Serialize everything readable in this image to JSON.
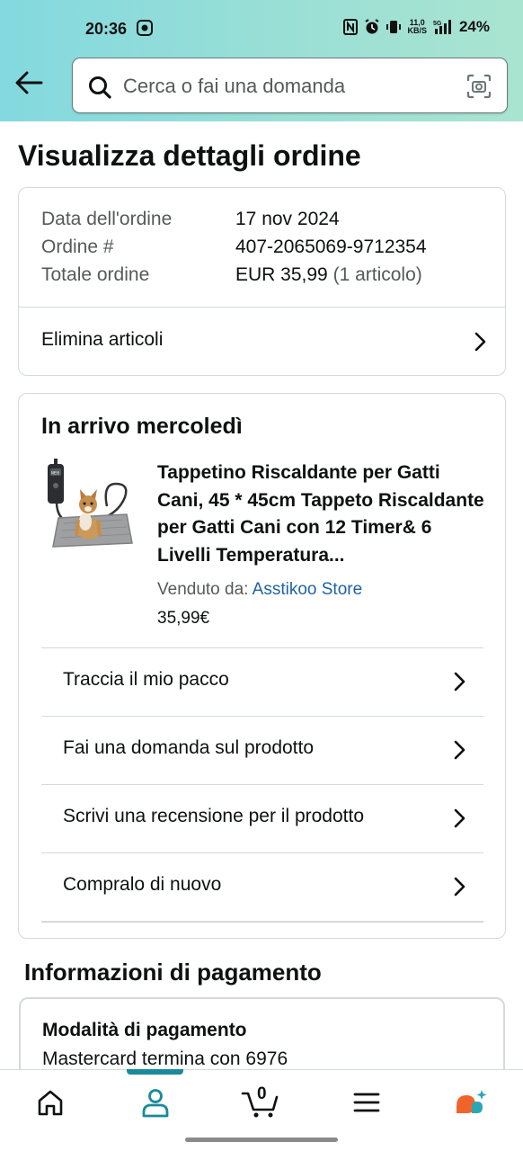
{
  "status_bar": {
    "time": "20:36",
    "network_speed_top": "11,0",
    "network_speed_bottom": "KB/S",
    "battery": "24%"
  },
  "header": {
    "back_icon": "arrow-left-icon",
    "search_placeholder": "Cerca o fai una domanda",
    "search_icon": "search-icon",
    "camera_icon": "camera-scan-icon"
  },
  "page": {
    "title": "Visualizza dettagli ordine"
  },
  "order_summary": {
    "date_label": "Data dell'ordine",
    "date_value": "17 nov 2024",
    "number_label": "Ordine #",
    "number_value": "407-2065069-9712354",
    "total_label": "Totale ordine",
    "total_value": "EUR 35,99",
    "total_items": "(1 articolo)",
    "delete_action": "Elimina articoli"
  },
  "shipment": {
    "heading": "In arrivo mercoledì",
    "product_title": "Tappetino Riscaldante per Gatti Cani, 45 * 45cm Tappeto Riscaldante per Gatti Cani con 12 Timer& 6 Livelli Temperatura...",
    "seller_label": "Venduto da:",
    "seller_name": "Asstikoo Store",
    "price": "35,99€",
    "actions": [
      "Traccia il mio pacco",
      "Fai una domanda sul prodotto",
      "Scrivi una recensione per il prodotto",
      "Compralo di nuovo"
    ]
  },
  "payment": {
    "section_title": "Informazioni di pagamento",
    "method_label": "Modalità di pagamento",
    "method_value": "Mastercard termina con 6976"
  },
  "bottom_nav": {
    "items": [
      "home-icon",
      "account-icon",
      "cart-icon",
      "menu-icon",
      "rufus-ai-icon"
    ],
    "cart_count": "0",
    "active": "account-icon",
    "accent_color": "#1a8a9a"
  },
  "colors": {
    "header_gradient_start": "#83d9df",
    "header_gradient_end": "#a9e4d0",
    "link": "#2162a1",
    "border": "#d5d9d9"
  }
}
